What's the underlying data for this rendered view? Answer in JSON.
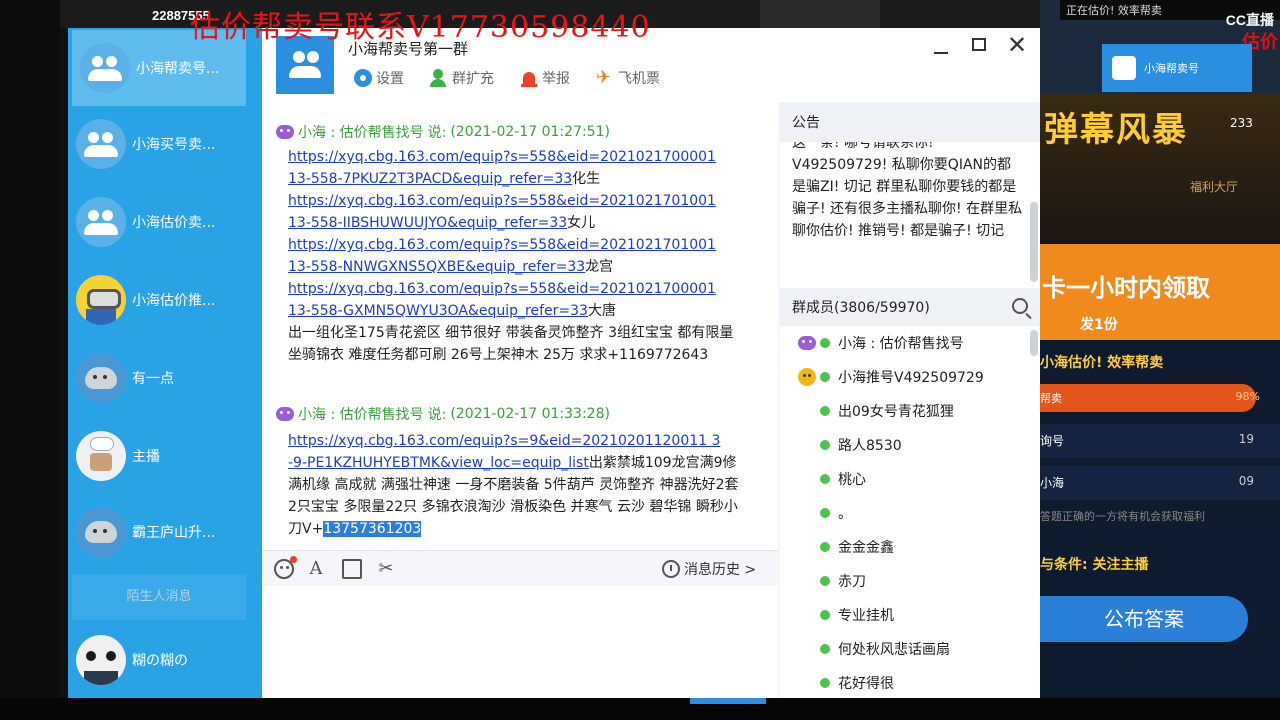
{
  "background": {
    "stamp": "22887555",
    "right_cc": "CC直播",
    "right_corner_red": "估价",
    "right_mini_window": "小海帮卖号",
    "right_top_text": "正在估价! 效率帮卖",
    "right_banner_title": "弹幕风暴",
    "right_banner_num": "233",
    "right_banner_sub": "福利大厅",
    "right_orange_title": "卡一小时内领取",
    "right_orange_sub": "发1份",
    "right_efficiency": "小海估价! 效率帮卖",
    "right_bar_label": "帮卖",
    "right_bar_value": "98%",
    "right_row1_label": "询号",
    "right_row1_value": "19",
    "right_row2_label": "小海",
    "right_row2_value": "09",
    "right_small_text": "答题正确的一方将有机会获取福利",
    "right_condition": "与条件: 关注主播",
    "right_publish": "公布答案"
  },
  "watermark": "估价帮卖号联系V17730598440",
  "sidebar": {
    "items": [
      {
        "label": "小海帮卖号...",
        "avatar": "group-avatar-icon"
      },
      {
        "label": "小海买号卖...",
        "avatar": "group-avatar-icon"
      },
      {
        "label": "小海估价卖...",
        "avatar": "group-avatar-icon"
      },
      {
        "label": "小海估价推...",
        "avatar": "minion-avatar-icon"
      },
      {
        "label": "有一点",
        "avatar": "blob-avatar-icon"
      },
      {
        "label": "主播",
        "avatar": "chef-avatar-icon"
      },
      {
        "label": "霸王庐山升...",
        "avatar": "blob-avatar-icon"
      },
      {
        "label": "糊の糊の",
        "avatar": "panda-avatar-icon"
      }
    ],
    "stranger_label": "陌生人消息"
  },
  "chat": {
    "title": "小海帮卖号第一群",
    "tools": {
      "settings": "设置",
      "expand": "群扩充",
      "report": "举报",
      "flight": "飞机票"
    },
    "messages": [
      {
        "sender": "小海 : 估价帮售找号",
        "said": "说:",
        "time": "(2021-02-17 01:27:51)",
        "lines": [
          {
            "link1": "https://xyq.cbg.163.com/equip?s=558&eid=2021021700001",
            "link2": "13-558-7PKUZ2T3PACD&equip_refer=33",
            "tail": "化生"
          },
          {
            "link1": "https://xyq.cbg.163.com/equip?s=558&eid=2021021701001",
            "link2": "13-558-IIBSHUWUUJYO&equip_refer=33",
            "tail": "女儿"
          },
          {
            "link1": "https://xyq.cbg.163.com/equip?s=558&eid=2021021701001",
            "link2": "13-558-NNWGXNS5QXBE&equip_refer=33",
            "tail": "龙宫"
          },
          {
            "link1": "https://xyq.cbg.163.com/equip?s=558&eid=2021021700001",
            "link2": "13-558-GXMN5QWYU3OA&equip_refer=33",
            "tail": "大唐"
          }
        ],
        "body": "出一组化圣175青花瓷区 细节很好 带装备灵饰整齐 3组红宝宝 都有限量坐骑锦衣 难度任务都可刷 26号上架神木 25万 求求+1169772643"
      },
      {
        "sender": "小海 : 估价帮售找号",
        "said": "说:",
        "time": "(2021-02-17 01:33:28)",
        "link1": "https://xyq.cbg.163.com/equip?s=9&eid=20210201120011 3",
        "link2": "-9-PE1KZHUHYEBTMK&view_loc=equip_list",
        "body": "出紫禁城109龙宫满9修 满机缘 高成就 满强壮神速 一身不磨装备 5件葫芦 灵饰整齐 神器洗好2套 2只宝宝 多限量22只 多锦衣浪淘沙 滑板染色 并寒气 云沙 碧华锦 瞬秒小刀V+",
        "highlight": "13757361203"
      }
    ],
    "history_label": "消息历史 >",
    "notice": {
      "title": "公告",
      "text": "这一条! 哪号请联系你! V492509729! 私聊你要QIAN的都是骗ZI! 切记 群里私聊你要钱的都是骗子! 还有很多主播私聊你! 在群里私聊你估价! 推销号! 都是骗子! 切记"
    },
    "members": {
      "title": "群成员(3806/59970)",
      "list": [
        {
          "name": "小海 : 估价帮售找号",
          "badge": "purple"
        },
        {
          "name": "小海推号V492509729",
          "badge": "yellow"
        },
        {
          "name": "出09女号青花狐狸",
          "badge": ""
        },
        {
          "name": "路人8530",
          "badge": ""
        },
        {
          "name": "桃心",
          "badge": ""
        },
        {
          "name": "。",
          "badge": ""
        },
        {
          "name": "金金金鑫",
          "badge": ""
        },
        {
          "name": "赤刀",
          "badge": ""
        },
        {
          "name": "专业挂机",
          "badge": ""
        },
        {
          "name": "何处秋风悲话画扇",
          "badge": ""
        },
        {
          "name": "花好得很",
          "badge": ""
        }
      ]
    }
  }
}
